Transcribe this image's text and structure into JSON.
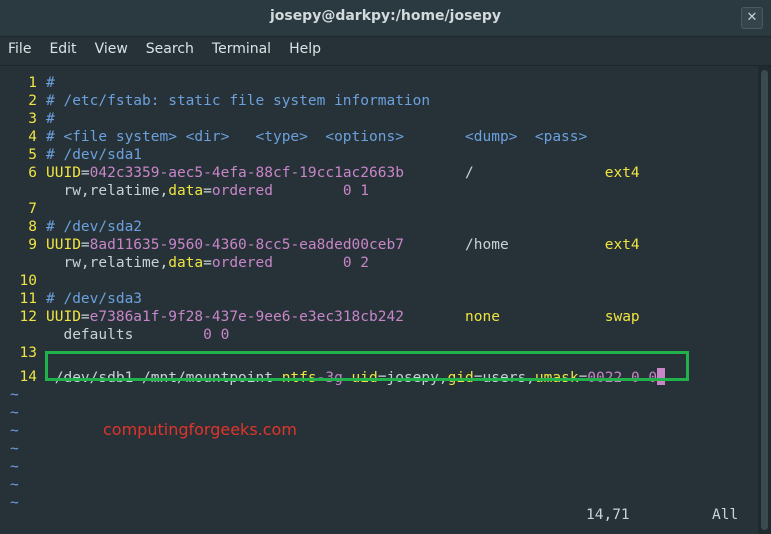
{
  "window": {
    "title": "josepy@darkpy:/home/josepy",
    "close_label": "✕"
  },
  "menu": [
    "File",
    "Edit",
    "View",
    "Search",
    "Terminal",
    "Help"
  ],
  "editor": {
    "lines": [
      {
        "n": "1",
        "parts": [
          [
            "#",
            "c"
          ]
        ]
      },
      {
        "n": "2",
        "parts": [
          [
            "# /etc/fstab: static file system information",
            "c"
          ]
        ]
      },
      {
        "n": "3",
        "parts": [
          [
            "#",
            "c"
          ]
        ]
      },
      {
        "n": "4",
        "parts": [
          [
            "# <file system> <dir>   <type>  <options>       <dump>  <pass>",
            "c"
          ]
        ]
      },
      {
        "n": "5",
        "parts": [
          [
            "# /dev/sda1",
            "c"
          ]
        ]
      },
      {
        "n": "6",
        "parts": [
          [
            "UUID",
            "k"
          ],
          [
            "=",
            "w"
          ],
          [
            "042c3359-aec5-4efa-88cf-19cc1ac2663b",
            "v"
          ],
          [
            "       /               ",
            "w"
          ],
          [
            "ext4",
            "k"
          ]
        ]
      },
      {
        "n": "",
        "parts": [
          [
            "  rw,relatime,",
            "w"
          ],
          [
            "data",
            "k"
          ],
          [
            "=",
            "w"
          ],
          [
            "ordered",
            "v"
          ],
          [
            "        0 1",
            "v"
          ]
        ]
      },
      {
        "n": "7",
        "parts": []
      },
      {
        "n": "8",
        "parts": [
          [
            "# /dev/sda2",
            "c"
          ]
        ]
      },
      {
        "n": "9",
        "parts": [
          [
            "UUID",
            "k"
          ],
          [
            "=",
            "w"
          ],
          [
            "8ad11635-9560-4360-8cc5-ea8ded00ceb7",
            "v"
          ],
          [
            "       /home           ",
            "w"
          ],
          [
            "ext4",
            "k"
          ]
        ]
      },
      {
        "n": "",
        "parts": [
          [
            "  rw,relatime,",
            "w"
          ],
          [
            "data",
            "k"
          ],
          [
            "=",
            "w"
          ],
          [
            "ordered",
            "v"
          ],
          [
            "        0 2",
            "v"
          ]
        ]
      },
      {
        "n": "10",
        "parts": []
      },
      {
        "n": "11",
        "parts": [
          [
            "# /dev/sda3",
            "c"
          ]
        ]
      },
      {
        "n": "12",
        "parts": [
          [
            "UUID",
            "k"
          ],
          [
            "=",
            "w"
          ],
          [
            "e7386a1f-9f28-437e-9ee6-e3ec318cb242",
            "v"
          ],
          [
            "       ",
            "w"
          ],
          [
            "none",
            "k"
          ],
          [
            "            ",
            "w"
          ],
          [
            "swap",
            "k"
          ]
        ]
      },
      {
        "n": "",
        "parts": [
          [
            "  defaults        ",
            "w"
          ],
          [
            "0 0",
            "v"
          ]
        ]
      },
      {
        "n": "13",
        "parts": []
      },
      {
        "n": "14",
        "parts": [
          [
            " /dev/sdb1 /mnt/mountpoint ",
            "w"
          ],
          [
            "ntfs",
            "k"
          ],
          [
            "-3g ",
            "v"
          ],
          [
            "uid",
            "k"
          ],
          [
            "=josepy,",
            "w"
          ],
          [
            "gid",
            "k"
          ],
          [
            "=users,",
            "w"
          ],
          [
            "umask",
            "k"
          ],
          [
            "=",
            "w"
          ],
          [
            "0022 0 0",
            "v"
          ]
        ]
      }
    ],
    "tildes": [
      "~",
      "~",
      "~",
      "~",
      "~",
      "~",
      "~"
    ],
    "watermark": "computingforgeeks.com",
    "position": "14,71",
    "scroll": "All"
  }
}
